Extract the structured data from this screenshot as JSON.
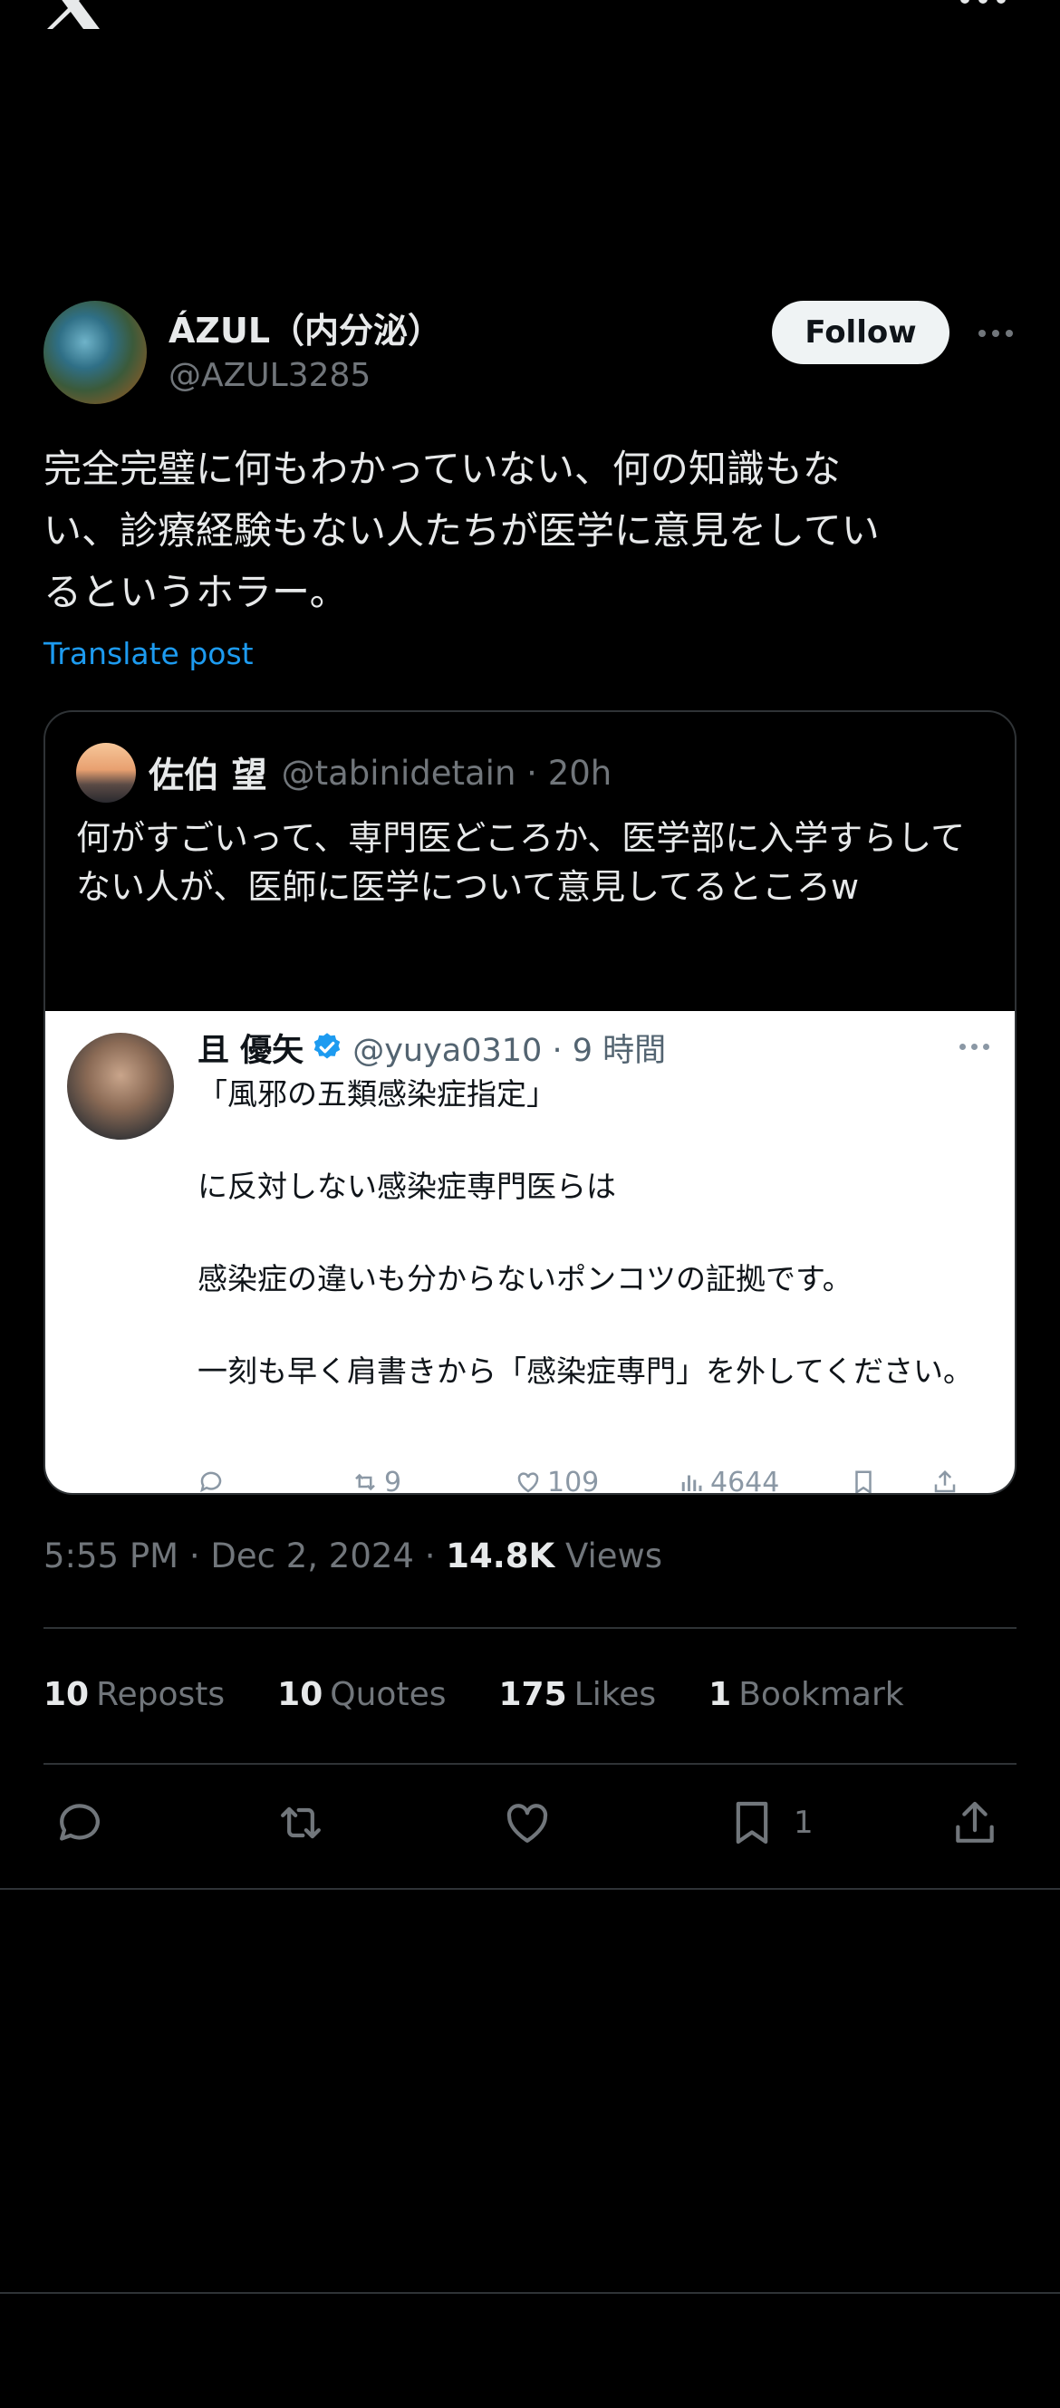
{
  "topbar": {
    "logo_icon": "x-logo-icon",
    "more_icon": "more-horizontal-icon"
  },
  "author": {
    "name": "ÁZUL（内分泌）",
    "handle": "@AZUL3285",
    "follow_label": "Follow",
    "more_icon": "more-horizontal-icon"
  },
  "post": {
    "text": "完全完璧に何もわかっていない、何の知識もな\nい、診療経験もない人たちが医学に意見をしてい\nるというホラー。",
    "translate_label": "Translate post"
  },
  "quote": {
    "name": "佐伯 望",
    "handle_time": "@tabinidetain · 20h",
    "text": "何がすごいって、専門医どころか、医学部に入学すらしてない人が、医師に医学について意見してるところw",
    "embedded": {
      "name": "且 優矢",
      "handle_time": "@yuya0310 · 9 時間",
      "lines": [
        "「風邪の五類感染症指定」",
        "に反対しない感染症専門医らは",
        "感染症の違いも分からないポンコツの証拠です。",
        "一刻も早く肩書きから「感染症専門」を外してください。"
      ],
      "actions": {
        "retweets": "9",
        "likes": "109",
        "views": "4644"
      }
    }
  },
  "meta": {
    "time_date": "5:55 PM · Dec 2, 2024 · ",
    "views_count": "14.8K",
    "views_label": " Views"
  },
  "stats": [
    {
      "count": "10",
      "label": "Reposts"
    },
    {
      "count": "10",
      "label": "Quotes"
    },
    {
      "count": "175",
      "label": "Likes"
    },
    {
      "count": "1",
      "label": "Bookmark"
    }
  ],
  "actions": {
    "bookmark_count": "1",
    "icons": [
      "reply-icon",
      "repost-icon",
      "like-icon",
      "bookmark-icon",
      "share-icon"
    ]
  },
  "colors": {
    "background": "#000000",
    "accent": "#1d9bf0",
    "text": "#e7e9ea",
    "muted": "#71767b"
  }
}
